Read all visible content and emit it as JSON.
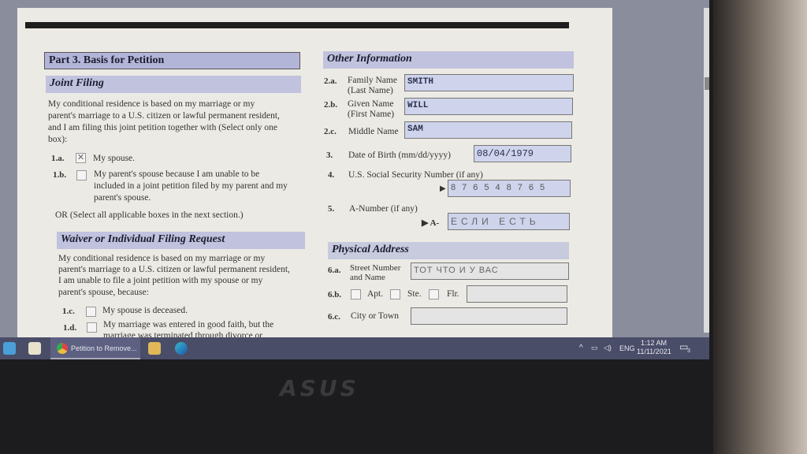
{
  "form": {
    "part_title": "Part 3.  Basis for Petition",
    "joint_filing": {
      "title": "Joint Filing",
      "intro_1": "My conditional residence is based on my marriage or my",
      "intro_2": "parent's marriage to a U.S. citizen or lawful permanent resident,",
      "intro_3": "and I am filing this joint petition together with (Select only one",
      "intro_4": "box):",
      "items": [
        {
          "num": "1.a.",
          "checked": true,
          "mark": "✕",
          "lines": [
            "My spouse."
          ]
        },
        {
          "num": "1.b.",
          "checked": false,
          "lines": [
            "My parent's spouse because I am unable to be",
            "included in a joint petition filed by my parent and my",
            "parent's spouse."
          ]
        }
      ],
      "or_note": "OR (Select all applicable boxes in the next section.)"
    },
    "waiver": {
      "title": "Waiver or Individual Filing Request",
      "intro_1": "My conditional residence is based on my marriage or my",
      "intro_2": "parent's marriage to a U.S. citizen or lawful permanent resident,",
      "intro_3": "I am unable to file a joint petition with my spouse or my",
      "intro_4": "parent's spouse, because:",
      "items": [
        {
          "num": "1.c.",
          "checked": false,
          "lines": [
            "My spouse is deceased."
          ]
        },
        {
          "num": "1.d.",
          "checked": false,
          "lines": [
            "My marriage was entered in good faith, but the",
            "marriage was terminated through divorce or"
          ]
        }
      ]
    },
    "other_info": {
      "title": "Other Information",
      "family_name": {
        "num": "2.a.",
        "label_1": "Family Name",
        "label_2": "(Last Name)",
        "value": "SMITH"
      },
      "given_name": {
        "num": "2.b.",
        "label_1": "Given Name",
        "label_2": "(First Name)",
        "value": "WILL"
      },
      "middle_name": {
        "num": "2.c.",
        "label": "Middle Name",
        "value": "SAM"
      },
      "dob": {
        "num": "3.",
        "label": "Date of Birth  (mm/dd/yyyy)",
        "value": "08/04/1979"
      },
      "ssn": {
        "num": "4.",
        "label": "U.S. Social Security Number (if any)",
        "arrow": "▶",
        "value": "876548765"
      },
      "a_number": {
        "num": "5.",
        "label": "A-Number (if any)",
        "prefix": "▶ A-",
        "value": "ЕСЛИ  ЕСТЬ"
      }
    },
    "physical_address": {
      "title": "Physical Address",
      "street": {
        "num": "6.a.",
        "label_1": "Street Number",
        "label_2": "and Name",
        "value": "ТОТ  ЧТО  И  У  ВАС"
      },
      "unit": {
        "num": "6.b.",
        "apt": "Apt.",
        "ste": "Ste.",
        "flr": "Flr.",
        "value": ""
      },
      "city": {
        "num": "6.c.",
        "label": "City or Town",
        "value": ""
      }
    }
  },
  "taskbar": {
    "active_window": "Petition to Remove...",
    "language": "ENG",
    "time": "1:12 AM",
    "date": "11/11/2021",
    "notification_count": "3"
  },
  "bezel": {
    "brand": "ASUS"
  }
}
